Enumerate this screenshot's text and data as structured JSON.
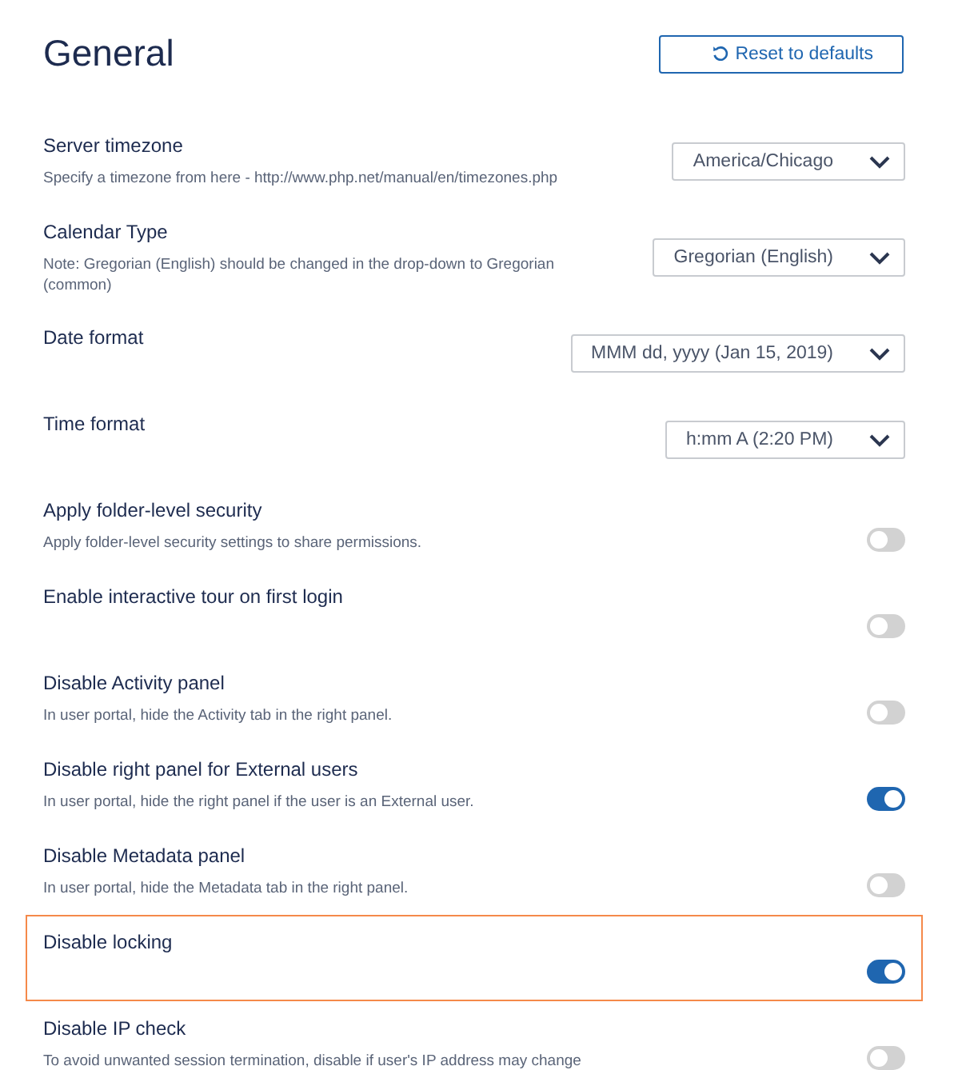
{
  "title": "General",
  "reset_button": {
    "label": "Reset to defaults"
  },
  "settings": [
    {
      "kind": "select",
      "label": "Server timezone",
      "description": "Specify a timezone from here - http://www.php.net/manual/en/timezones.php",
      "value": "America/Chicago",
      "highlighted": false
    },
    {
      "kind": "select",
      "label": "Calendar Type",
      "description": "Note: Gregorian (English) should be changed in the drop-down to Gregorian (common)",
      "value": "Gregorian (English)",
      "highlighted": false
    },
    {
      "kind": "select",
      "label": "Date format",
      "value": "MMM dd, yyyy (Jan 15, 2019)",
      "highlighted": false
    },
    {
      "kind": "select",
      "label": "Time format",
      "value": "h:mm A (2:20 PM)",
      "highlighted": false
    },
    {
      "kind": "toggle",
      "label": "Apply folder-level security",
      "description": "Apply folder-level security settings to share permissions.",
      "on": false,
      "highlighted": false
    },
    {
      "kind": "toggle",
      "label": "Enable interactive tour on first login",
      "on": false,
      "highlighted": false
    },
    {
      "kind": "toggle",
      "label": "Disable Activity panel",
      "description": "In user portal, hide the Activity tab in the right panel.",
      "on": false,
      "highlighted": false
    },
    {
      "kind": "toggle",
      "label": "Disable right panel for External users",
      "description": "In user portal, hide the right panel if the user is an External user.",
      "on": true,
      "highlighted": false
    },
    {
      "kind": "toggle",
      "label": "Disable Metadata panel",
      "description": "In user portal, hide the Metadata tab in the right panel.",
      "on": false,
      "highlighted": false
    },
    {
      "kind": "toggle",
      "label": "Disable locking",
      "on": true,
      "highlighted": true
    },
    {
      "kind": "toggle",
      "label": "Disable IP check",
      "description": "To avoid unwanted session termination, disable if user's IP address may change",
      "on": false,
      "highlighted": false
    }
  ]
}
